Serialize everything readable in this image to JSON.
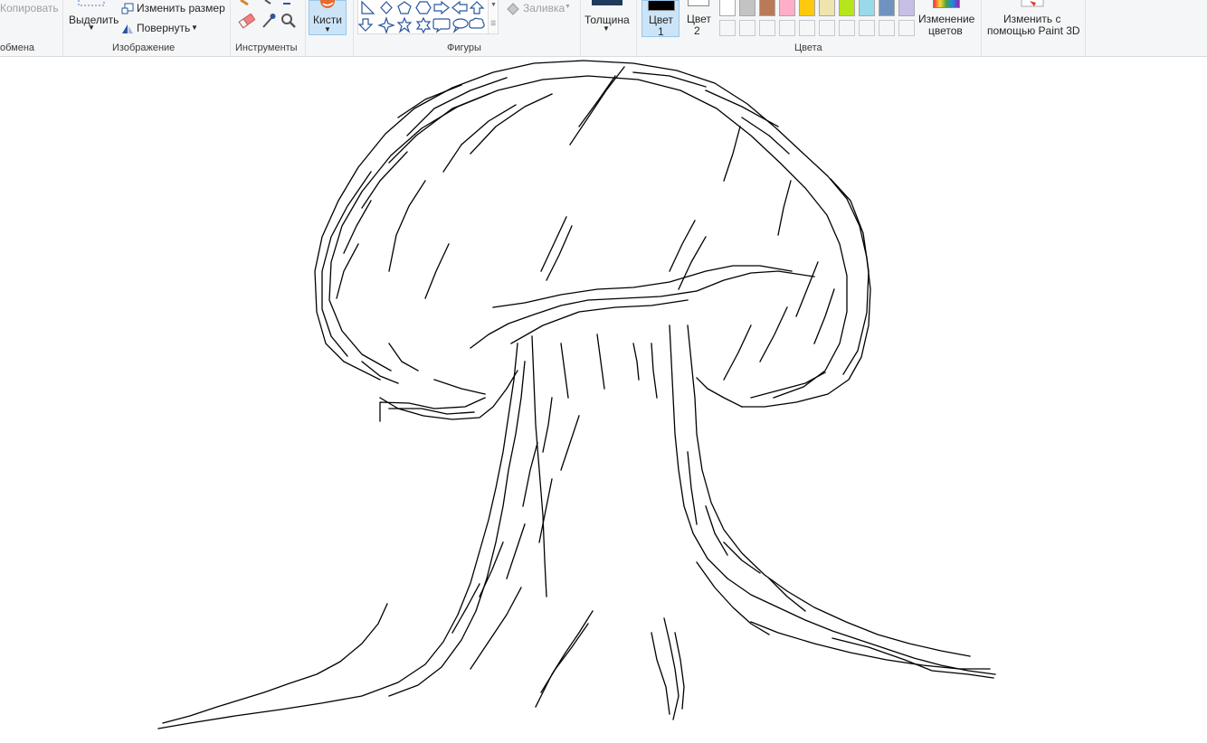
{
  "ribbon": {
    "clipboard": {
      "copy_label": "Копировать",
      "group_label": "обмена"
    },
    "image": {
      "select_label": "Выделить",
      "resize_label": "Изменить размер",
      "rotate_label": "Повернуть",
      "group_label": "Изображение"
    },
    "tools": {
      "group_label": "Инструменты"
    },
    "brushes": {
      "label": "Кисти"
    },
    "shapes": {
      "fill_label": "Заливка",
      "group_label": "Фигуры"
    },
    "thickness": {
      "label": "Толщина"
    },
    "colors": {
      "color1_line1": "Цвет",
      "color1_line2": "1",
      "color2_line1": "Цвет",
      "color2_line2": "2",
      "edit_line1": "Изменение",
      "edit_line2": "цветов",
      "group_label": "Цвета",
      "color1_value": "#000000",
      "color2_value": "#ffffff",
      "palette_row1": [
        "#ffffff",
        "#c3c3c3",
        "#b97a57",
        "#ffaec9",
        "#ffc90e",
        "#efe4b0",
        "#b5e61d",
        "#99d9ea",
        "#7092be",
        "#c8bfe7"
      ]
    },
    "paint3d": {
      "line1": "Изменить с",
      "line2": "помощью Paint 3D"
    }
  }
}
